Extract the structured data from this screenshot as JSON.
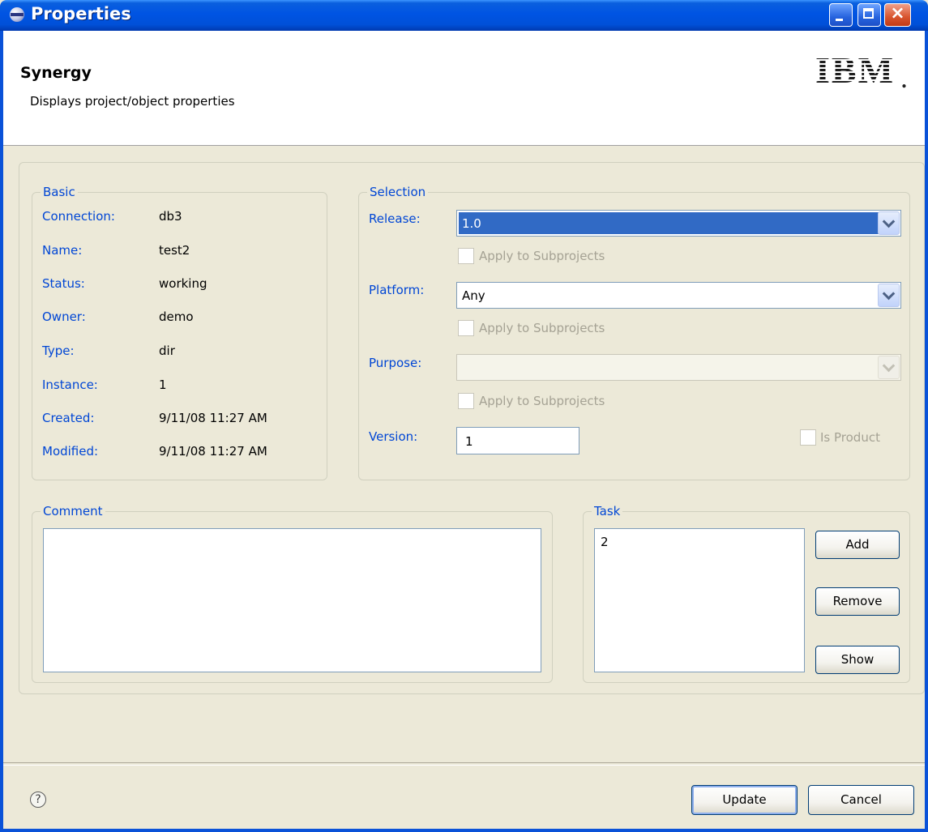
{
  "window": {
    "title": "Properties"
  },
  "header": {
    "title": "Synergy",
    "description": "Displays project/object properties",
    "logo_text": "IBM",
    "logo_dot": "."
  },
  "basic": {
    "legend": "Basic",
    "fields": [
      {
        "label": "Connection:",
        "value": "db3"
      },
      {
        "label": "Name:",
        "value": "test2"
      },
      {
        "label": "Status:",
        "value": "working"
      },
      {
        "label": "Owner:",
        "value": "demo"
      },
      {
        "label": "Type:",
        "value": "dir"
      },
      {
        "label": "Instance:",
        "value": "1"
      },
      {
        "label": "Created:",
        "value": "9/11/08 11:27 AM"
      },
      {
        "label": "Modified:",
        "value": "9/11/08 11:27 AM"
      }
    ]
  },
  "selection": {
    "legend": "Selection",
    "release": {
      "label": "Release:",
      "value": "1.0",
      "apply_label": "Apply to Subprojects"
    },
    "platform": {
      "label": "Platform:",
      "value": "Any",
      "apply_label": "Apply to Subprojects"
    },
    "purpose": {
      "label": "Purpose:",
      "value": "",
      "apply_label": "Apply to Subprojects"
    },
    "version": {
      "label": "Version:",
      "value": "1"
    },
    "is_product_label": "Is Product"
  },
  "comment": {
    "legend": "Comment",
    "value": ""
  },
  "task": {
    "legend": "Task",
    "items": [
      "2"
    ],
    "add_label": "Add",
    "remove_label": "Remove",
    "show_label": "Show"
  },
  "footer": {
    "help_glyph": "?",
    "update_label": "Update",
    "cancel_label": "Cancel"
  }
}
